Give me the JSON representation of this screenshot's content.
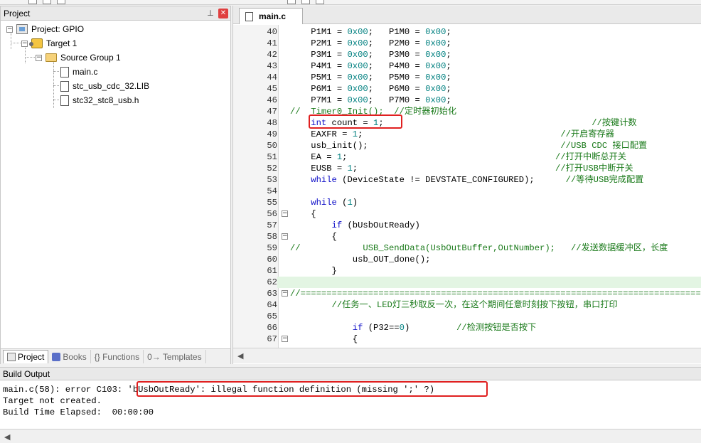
{
  "project_panel": {
    "title": "Project",
    "pin_glyph": "⊥",
    "close_glyph": "✕",
    "tree": {
      "project": "Project: GPIO",
      "target": "Target 1",
      "group": "Source Group 1",
      "files": [
        "main.c",
        "stc_usb_cdc_32.LIB",
        "stc32_stc8_usb.h"
      ]
    },
    "tabs": [
      "Project",
      "Books",
      "{} Functions",
      "0→ Templates"
    ]
  },
  "editor": {
    "file_tab": "main.c",
    "lines": [
      {
        "n": "40",
        "fold": "",
        "tokens": [
          [
            "pl",
            "    P1M1 = "
          ],
          [
            "num",
            "0x00"
          ],
          [
            "pl",
            ";   P1M0 = "
          ],
          [
            "num",
            "0x00"
          ],
          [
            "pl",
            ";"
          ]
        ]
      },
      {
        "n": "41",
        "fold": "",
        "tokens": [
          [
            "pl",
            "    P2M1 = "
          ],
          [
            "num",
            "0x00"
          ],
          [
            "pl",
            ";   P2M0 = "
          ],
          [
            "num",
            "0x00"
          ],
          [
            "pl",
            ";"
          ]
        ]
      },
      {
        "n": "42",
        "fold": "",
        "tokens": [
          [
            "pl",
            "    P3M1 = "
          ],
          [
            "num",
            "0x00"
          ],
          [
            "pl",
            ";   P3M0 = "
          ],
          [
            "num",
            "0x00"
          ],
          [
            "pl",
            ";"
          ]
        ]
      },
      {
        "n": "43",
        "fold": "",
        "tokens": [
          [
            "pl",
            "    P4M1 = "
          ],
          [
            "num",
            "0x00"
          ],
          [
            "pl",
            ";   P4M0 = "
          ],
          [
            "num",
            "0x00"
          ],
          [
            "pl",
            ";"
          ]
        ]
      },
      {
        "n": "44",
        "fold": "",
        "tokens": [
          [
            "pl",
            "    P5M1 = "
          ],
          [
            "num",
            "0x00"
          ],
          [
            "pl",
            ";   P5M0 = "
          ],
          [
            "num",
            "0x00"
          ],
          [
            "pl",
            ";"
          ]
        ]
      },
      {
        "n": "45",
        "fold": "",
        "tokens": [
          [
            "pl",
            "    P6M1 = "
          ],
          [
            "num",
            "0x00"
          ],
          [
            "pl",
            ";   P6M0 = "
          ],
          [
            "num",
            "0x00"
          ],
          [
            "pl",
            ";"
          ]
        ]
      },
      {
        "n": "46",
        "fold": "",
        "tokens": [
          [
            "pl",
            "    P7M1 = "
          ],
          [
            "num",
            "0x00"
          ],
          [
            "pl",
            ";   P7M0 = "
          ],
          [
            "num",
            "0x00"
          ],
          [
            "pl",
            ";"
          ]
        ]
      },
      {
        "n": "47",
        "fold": "",
        "tokens": [
          [
            "cm",
            "//  Timer0_Init();  //定时器初始化"
          ]
        ]
      },
      {
        "n": "48",
        "fold": "",
        "tokens": [
          [
            "kw",
            "    int"
          ],
          [
            "pl",
            " count = "
          ],
          [
            "num",
            "1"
          ],
          [
            "pl",
            ";                                        "
          ],
          [
            "cm",
            "//按键计数"
          ]
        ]
      },
      {
        "n": "49",
        "fold": "",
        "tokens": [
          [
            "pl",
            "    EAXFR = "
          ],
          [
            "num",
            "1"
          ],
          [
            "pl",
            ";                                      "
          ],
          [
            "cm",
            "//开启寄存器"
          ]
        ]
      },
      {
        "n": "50",
        "fold": "",
        "tokens": [
          [
            "pl",
            "    usb_init();                                     "
          ],
          [
            "cm",
            "//USB CDC 接口配置"
          ]
        ]
      },
      {
        "n": "51",
        "fold": "",
        "tokens": [
          [
            "pl",
            "    EA = "
          ],
          [
            "num",
            "1"
          ],
          [
            "pl",
            ";                                        "
          ],
          [
            "cm",
            "//打开中断总开关"
          ]
        ]
      },
      {
        "n": "52",
        "fold": "",
        "tokens": [
          [
            "pl",
            "    EUSB = "
          ],
          [
            "num",
            "1"
          ],
          [
            "pl",
            ";                                      "
          ],
          [
            "cm",
            "//打开USB中断开关"
          ]
        ]
      },
      {
        "n": "53",
        "fold": "",
        "tokens": [
          [
            "kw",
            "    while"
          ],
          [
            "pl",
            " (DeviceState != DEVSTATE_CONFIGURED);      "
          ],
          [
            "cm",
            "//等待USB完成配置"
          ]
        ]
      },
      {
        "n": "54",
        "fold": "",
        "tokens": [
          [
            "pl",
            ""
          ]
        ]
      },
      {
        "n": "55",
        "fold": "",
        "tokens": [
          [
            "kw",
            "    while"
          ],
          [
            "pl",
            " ("
          ],
          [
            "num",
            "1"
          ],
          [
            "pl",
            ")"
          ]
        ]
      },
      {
        "n": "56",
        "fold": "⊟",
        "tokens": [
          [
            "pl",
            "    {"
          ]
        ]
      },
      {
        "n": "57",
        "fold": "",
        "tokens": [
          [
            "kw",
            "        if"
          ],
          [
            "pl",
            " (bUsbOutReady)"
          ]
        ]
      },
      {
        "n": "58",
        "fold": "⊟",
        "tokens": [
          [
            "pl",
            "        {"
          ]
        ]
      },
      {
        "n": "59",
        "fold": "",
        "tokens": [
          [
            "cm",
            "//            USB_SendData(UsbOutBuffer,OutNumber);   //发送数据缓冲区，长度"
          ]
        ]
      },
      {
        "n": "60",
        "fold": "",
        "tokens": [
          [
            "pl",
            "            usb_OUT_done();"
          ]
        ]
      },
      {
        "n": "61",
        "fold": "",
        "tokens": [
          [
            "pl",
            "        }"
          ]
        ]
      },
      {
        "n": "62",
        "fold": "",
        "tokens": [
          [
            "pl",
            ""
          ]
        ],
        "highlight": true
      },
      {
        "n": "63",
        "fold": "⊟",
        "tokens": [
          [
            "cm",
            "//=============================================================================="
          ]
        ]
      },
      {
        "n": "64",
        "fold": "",
        "tokens": [
          [
            "cm",
            "        //任务一、LED灯三秒取反一次，在这个期间任意时刻按下按钮，串口打印"
          ]
        ]
      },
      {
        "n": "65",
        "fold": "",
        "tokens": [
          [
            "pl",
            ""
          ]
        ]
      },
      {
        "n": "66",
        "fold": "",
        "tokens": [
          [
            "kw",
            "            if"
          ],
          [
            "pl",
            " (P32=="
          ],
          [
            "num",
            "0"
          ],
          [
            "pl",
            ")         "
          ],
          [
            "cm",
            "//检测按钮是否按下"
          ]
        ]
      },
      {
        "n": "67",
        "fold": "⊟",
        "tokens": [
          [
            "pl",
            "            {"
          ]
        ]
      }
    ]
  },
  "build_output": {
    "title": "Build Output",
    "lines": [
      "main.c(58): error C103: 'bUsbOutReady': illegal function definition (missing ';' ?)",
      "Target not created.",
      "Build Time Elapsed:  00:00:00"
    ]
  },
  "colors": {
    "keyword": "#1010c8",
    "number": "#008080",
    "comment": "#1a7a1a",
    "annotation": "#e02020",
    "current_line": "#e3f5e3"
  }
}
